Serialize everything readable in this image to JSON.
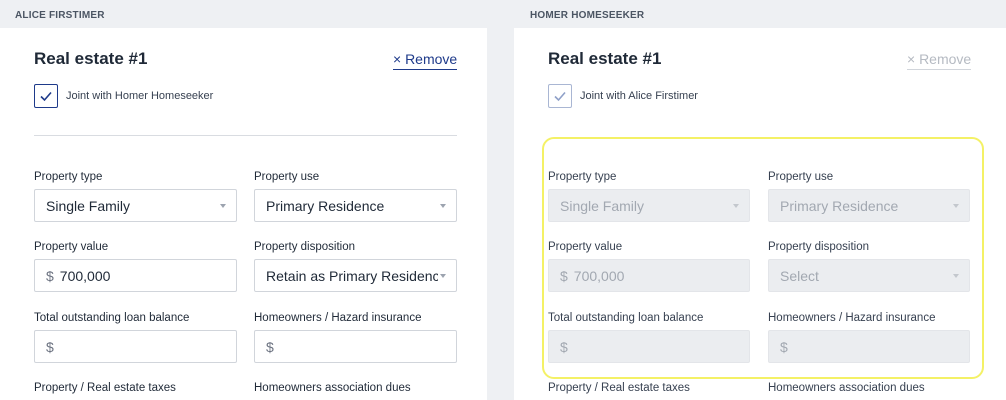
{
  "left": {
    "header": "ALICE FIRSTIMER",
    "title": "Real estate #1",
    "remove_label": "× Remove",
    "joint_label": "Joint with Homer Homeseeker",
    "fields": {
      "property_type_label": "Property type",
      "property_type_value": "Single Family",
      "property_use_label": "Property use",
      "property_use_value": "Primary Residence",
      "property_value_label": "Property value",
      "property_value_prefix": "$",
      "property_value_value": "700,000",
      "disposition_label": "Property disposition",
      "disposition_value": "Retain as Primary Residence",
      "loan_label": "Total outstanding loan balance",
      "loan_prefix": "$",
      "insurance_label": "Homeowners / Hazard insurance",
      "insurance_prefix": "$",
      "taxes_label": "Property / Real estate taxes",
      "hoa_label": "Homeowners association dues"
    }
  },
  "right": {
    "header": "HOMER HOMESEEKER",
    "title": "Real estate #1",
    "remove_label": "× Remove",
    "joint_label": "Joint with Alice Firstimer",
    "fields": {
      "property_type_label": "Property type",
      "property_type_value": "Single Family",
      "property_use_label": "Property use",
      "property_use_value": "Primary Residence",
      "property_value_label": "Property value",
      "property_value_prefix": "$",
      "property_value_value": "700,000",
      "disposition_label": "Property disposition",
      "disposition_value": "Select",
      "loan_label": "Total outstanding loan balance",
      "loan_prefix": "$",
      "insurance_label": "Homeowners / Hazard insurance",
      "insurance_prefix": "$",
      "taxes_label": "Property / Real estate taxes",
      "hoa_label": "Homeowners association dues"
    }
  },
  "colors": {
    "accent": "#1e3a8a",
    "highlight": "#f4f166",
    "disabled_field": "#ebedf0"
  }
}
